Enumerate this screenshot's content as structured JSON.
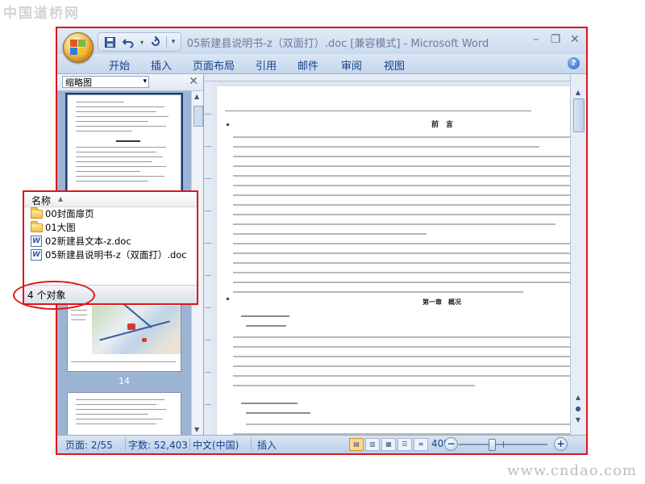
{
  "watermarks": {
    "top_left": "中国道桥网",
    "bottom_right": "www.cndao.com"
  },
  "window": {
    "title": "05新建县说明书-z（双面打）.doc [兼容模式] - Microsoft Word",
    "ribbon_tabs": [
      "开始",
      "插入",
      "页面布局",
      "引用",
      "邮件",
      "审阅",
      "视图"
    ],
    "quick_access": {
      "save_icon": "save-icon",
      "undo_icon": "undo-icon",
      "redo_icon": "redo-icon"
    },
    "help_label": "?"
  },
  "nav_pane": {
    "mode": "缩略图",
    "close_label": "✕",
    "page_number_label": "14"
  },
  "document": {
    "heading_preface": "前　言",
    "heading_chapter": "第一章　概况"
  },
  "explorer_popup": {
    "column_header": "名称",
    "items": [
      {
        "type": "folder",
        "name": "00封面扉页"
      },
      {
        "type": "folder",
        "name": "01大图"
      },
      {
        "type": "word",
        "name": "02新建县文本-z.doc"
      },
      {
        "type": "word",
        "name": "05新建县说明书-z（双面打）.doc"
      }
    ],
    "object_count": "4 个对象"
  },
  "status_bar": {
    "page": "页面: 2/55",
    "words": "字数: 52,403",
    "language": "中文(中国)",
    "insert_mode": "插入",
    "zoom": "40%",
    "zoom_level_percent": 40
  },
  "colors": {
    "highlight": "#e0141b",
    "ribbon_text": "#15428b"
  }
}
